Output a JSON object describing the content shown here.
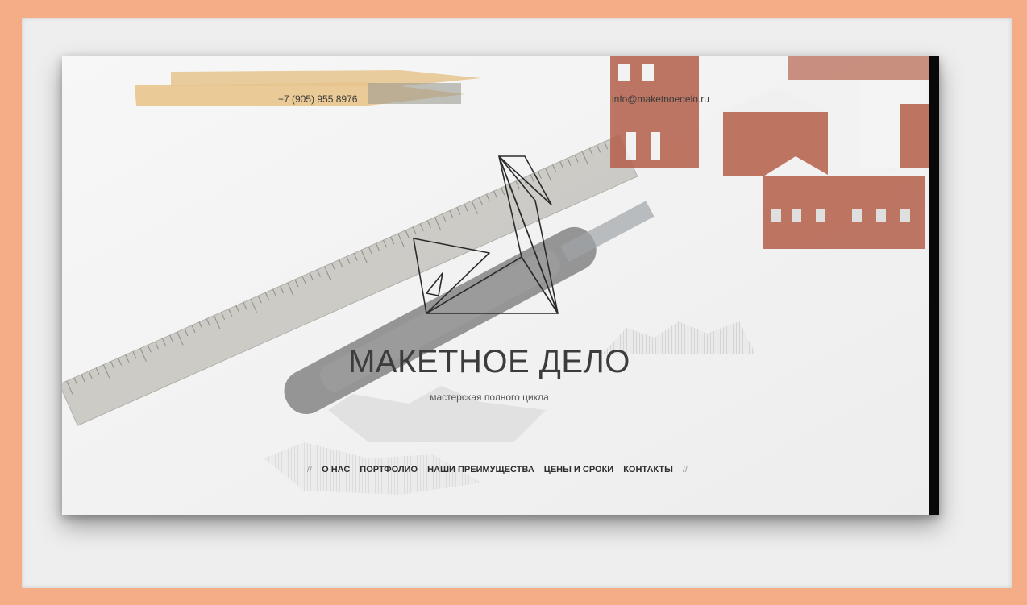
{
  "header": {
    "phone": "+7 (905) 955 8976",
    "email": "info@maketnoedelo.ru"
  },
  "brand": {
    "title": "МАКЕТНОЕ ДЕЛО",
    "subtitle": "мастерская полного цикла",
    "logo_icon": "origami-swan-icon"
  },
  "nav": {
    "separator_left": "//",
    "separator_right": "//",
    "items": [
      {
        "label": "О НАС"
      },
      {
        "label": "ПОРТФОЛИО"
      },
      {
        "label": "НАШИ ПРЕИМУЩЕСТВА"
      },
      {
        "label": "ЦЕНЫ И СРОКИ"
      },
      {
        "label": "КОНТАКТЫ"
      }
    ]
  },
  "colors": {
    "frame": "#f4ad86",
    "matte": "#eeeeee",
    "brick": "#b4604a"
  }
}
